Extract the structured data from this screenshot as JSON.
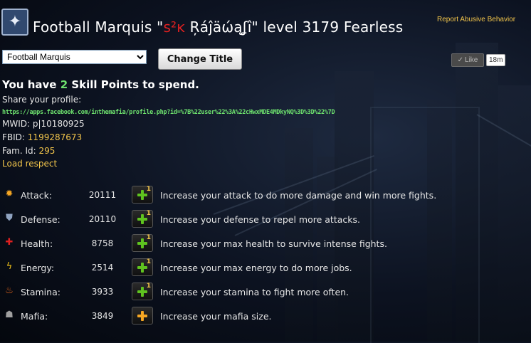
{
  "header": {
    "player_name": "Football Marquis",
    "quote_open": "\"",
    "title_red": "s²ĸ",
    "title_fancy": "Ŗáĵäώąʆî",
    "quote_close": "\"",
    "level_label": "level",
    "level": "3179",
    "rank": "Fearless",
    "report_link": "Report Abusive Behavior"
  },
  "controls": {
    "title_select_value": "Football Marquis",
    "change_title_label": "Change Title",
    "like_label": "Like",
    "like_count": "18m"
  },
  "profile": {
    "skill_prefix": "You have",
    "skill_points": "2",
    "skill_suffix": "Skill Points to spend.",
    "share_label": "Share your profile:",
    "share_link": "https://apps.facebook.com/inthemafia/profile.php?id=%7B%22user%22%3A%22cHwxMDE4MDkyNQ%3D%3D%22%7D",
    "mwid_label": "MWID:",
    "mwid_value": "p|10180925",
    "fbid_label": "FBID:",
    "fbid_value": "1199287673",
    "fam_label": "Fam. Id:",
    "fam_value": "295",
    "load_respect": "Load respect"
  },
  "stats": [
    {
      "name": "Attack:",
      "value": "20111",
      "desc": "Increase your attack to do more damage and win more fights.",
      "icon": "explosion-icon",
      "plus_color": "#5fc31f",
      "plus_badge": "1"
    },
    {
      "name": "Defense:",
      "value": "20110",
      "desc": "Increase your defense to repel more attacks.",
      "icon": "shield-icon",
      "plus_color": "#5fc31f",
      "plus_badge": "1"
    },
    {
      "name": "Health:",
      "value": "8758",
      "desc": "Increase your max health to survive intense fights.",
      "icon": "red-cross-icon",
      "plus_color": "#5fc31f",
      "plus_badge": "1"
    },
    {
      "name": "Energy:",
      "value": "2514",
      "desc": "Increase your max energy to do more jobs.",
      "icon": "lightning-icon",
      "plus_color": "#5fc31f",
      "plus_badge": "1"
    },
    {
      "name": "Stamina:",
      "value": "3933",
      "desc": "Increase your stamina to fight more often.",
      "icon": "flame-icon",
      "plus_color": "#5fc31f",
      "plus_badge": "1"
    },
    {
      "name": "Mafia:",
      "value": "3849",
      "desc": "Increase your mafia size.",
      "icon": "mafia-group-icon",
      "plus_color": "#f5a623",
      "plus_badge": ""
    }
  ]
}
